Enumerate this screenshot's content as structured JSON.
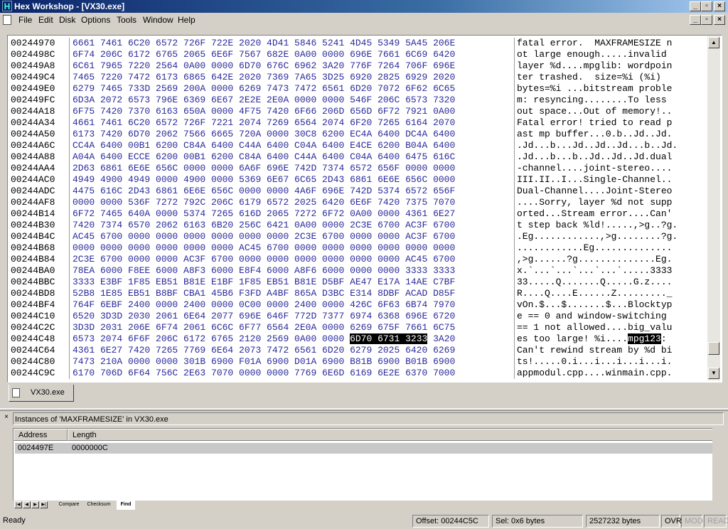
{
  "window": {
    "title": "Hex Workshop - [VX30.exe]"
  },
  "menu": [
    "File",
    "Edit",
    "Disk",
    "Options",
    "Tools",
    "Window",
    "Help"
  ],
  "hex_rows": [
    {
      "addr": "00244970",
      "hex": "6661 7461 6C20 6572 726F 722E 2020 4D41 5846 5241 4D45 5349 5A45 206E",
      "ascii": "fatal error.  MAXFRAMESIZE n"
    },
    {
      "addr": "0024498C",
      "hex": "6F74 206C 6172 6765 2065 6E6F 7567 682E 0A00 0000 696E 7661 6C69 6420",
      "ascii": "ot large enough.....invalid "
    },
    {
      "addr": "002449A8",
      "hex": "6C61 7965 7220 2564 0A00 0000 6D70 676C 6962 3A20 776F 7264 706F 696E",
      "ascii": "layer %d....mpglib: wordpoin"
    },
    {
      "addr": "002449C4",
      "hex": "7465 7220 7472 6173 6865 642E 2020 7369 7A65 3D25 6920 2825 6929 2020",
      "ascii": "ter trashed.  size=%i (%i)  "
    },
    {
      "addr": "002449E0",
      "hex": "6279 7465 733D 2569 200A 0000 6269 7473 7472 6561 6D20 7072 6F62 6C65",
      "ascii": "bytes=%i ...bitstream proble"
    },
    {
      "addr": "002449FC",
      "hex": "6D3A 2072 6573 796E 6369 6E67 2E2E 2E0A 0000 0000 546F 206C 6573 7320",
      "ascii": "m: resyncing........To less "
    },
    {
      "addr": "00244A18",
      "hex": "6F75 7420 7370 6163 650A 0000 4F75 7420 6F66 206D 656D 6F72 7921 0A00",
      "ascii": "out space...Out of memory!.."
    },
    {
      "addr": "00244A34",
      "hex": "4661 7461 6C20 6572 726F 7221 2074 7269 6564 2074 6F20 7265 6164 2070",
      "ascii": "Fatal error! tried to read p"
    },
    {
      "addr": "00244A50",
      "hex": "6173 7420 6D70 2062 7566 6665 720A 0000 30C8 6200 EC4A 6400 DC4A 6400",
      "ascii": "ast mp buffer...0.b..Jd..Jd."
    },
    {
      "addr": "00244A6C",
      "hex": "CC4A 6400 00B1 6200 C84A 6400 C44A 6400 C04A 6400 E4CE 6200 B04A 6400",
      "ascii": ".Jd...b...Jd..Jd..Jd...b..Jd."
    },
    {
      "addr": "00244A88",
      "hex": "A04A 6400 ECCE 6200 00B1 6200 C84A 6400 C44A 6400 C04A 6400 6475 616C",
      "ascii": ".Jd...b...b..Jd..Jd..Jd.dual"
    },
    {
      "addr": "00244AA4",
      "hex": "2D63 6861 6E6E 656C 0000 0000 6A6F 696E 742D 7374 6572 656F 0000 0000",
      "ascii": "-channel....joint-stereo...."
    },
    {
      "addr": "00244AC0",
      "hex": "4949 4900 4949 0000 4900 0000 5369 6E67 6C65 2D43 6861 6E6E 656C 0000",
      "ascii": "III.II..I...Single-Channel.."
    },
    {
      "addr": "00244ADC",
      "hex": "4475 616C 2D43 6861 6E6E 656C 0000 0000 4A6F 696E 742D 5374 6572 656F",
      "ascii": "Dual-Channel....Joint-Stereo"
    },
    {
      "addr": "00244AF8",
      "hex": "0000 0000 536F 7272 792C 206C 6179 6572 2025 6420 6E6F 7420 7375 7070",
      "ascii": "....Sorry, layer %d not supp"
    },
    {
      "addr": "00244B14",
      "hex": "6F72 7465 640A 0000 5374 7265 616D 2065 7272 6F72 0A00 0000 4361 6E27",
      "ascii": "orted...Stream error....Can'"
    },
    {
      "addr": "00244B30",
      "hex": "7420 7374 6570 2062 6163 6B20 256C 6421 0A00 0000 2C3E 6700 AC3F 6700",
      "ascii": "t step back %ld!.....,>g..?g."
    },
    {
      "addr": "00244B4C",
      "hex": "AC45 6700 0000 0000 0000 0000 0000 0000 2C3E 6700 0000 0000 AC3F 6700",
      "ascii": ".Eg............,>g........?g."
    },
    {
      "addr": "00244B68",
      "hex": "0000 0000 0000 0000 0000 0000 AC45 6700 0000 0000 0000 0000 0000 0000",
      "ascii": "............Eg.............."
    },
    {
      "addr": "00244B84",
      "hex": "2C3E 6700 0000 0000 AC3F 6700 0000 0000 0000 0000 0000 0000 AC45 6700",
      "ascii": ",>g......?g..............Eg."
    },
    {
      "addr": "00244BA0",
      "hex": "78EA 6000 F8EE 6000 A8F3 6000 E8F4 6000 A8F6 6000 0000 0000 3333 3333",
      "ascii": "x.`...`...`...`...`.....3333"
    },
    {
      "addr": "00244BBC",
      "hex": "3333 E3BF 1F85 EB51 B81E E1BF 1F85 EB51 B81E D5BF AE47 E17A 14AE C7BF",
      "ascii": "33.....Q.......Q.....G.z...."
    },
    {
      "addr": "00244BD8",
      "hex": "52B8 1E85 EB51 B8BF CBA1 45B6 F3FD A4BF 865A D3BC E314 8DBF ACAD D85F",
      "ascii": "R....Q....E......Z........._"
    },
    {
      "addr": "00244BF4",
      "hex": "764F 6EBF 2400 0000 2400 0000 0C00 0000 2400 0000 426C 6F63 6B74 7970",
      "ascii": "vOn.$...$.......$...Blocktyp"
    },
    {
      "addr": "00244C10",
      "hex": "6520 3D3D 2030 2061 6E64 2077 696E 646F 772D 7377 6974 6368 696E 6720",
      "ascii": "e == 0 and window-switching "
    },
    {
      "addr": "00244C2C",
      "hex": "3D3D 2031 206E 6F74 2061 6C6C 6F77 6564 2E0A 0000 6269 675F 7661 6C75",
      "ascii": "== 1 not allowed....big_valu"
    },
    {
      "addr": "00244C48",
      "hex": "6573 2074 6F6F 206C 6172 6765 2120 2569 0A00 0000 ",
      "hexsel": "6D70 6731 3233",
      "hexafter": " 3A20",
      "ascii": "es too large! %i....",
      "asciisel": "mpg123",
      "asciiafter": ": "
    },
    {
      "addr": "00244C64",
      "hex": "4361 6E27 7420 7265 7769 6E64 2073 7472 6561 6D20 6279 2025 6420 6269",
      "ascii": "Can't rewind stream by %d bi"
    },
    {
      "addr": "00244C80",
      "hex": "7473 210A 0000 0000 301B 6900 F01A 6900 D01A 6900 B81B 6900 B01B 6900",
      "ascii": "ts!.....0.i...i...i...i...i."
    },
    {
      "addr": "00244C9C",
      "hex": "6170 706D 6F64 756C 2E63 7070 0000 0000 7769 6E6D 6169 6E2E 6370 7000",
      "ascii": "appmodul.cpp....winmain.cpp."
    }
  ],
  "doc_tab": "VX30.exe",
  "find_panel": {
    "caption": "Instances of 'MAXFRAMESIZE' in VX30.exe",
    "columns": [
      "Address",
      "Length"
    ],
    "results": [
      {
        "address": "0024497E",
        "length": "0000000C"
      }
    ]
  },
  "bottom_tabs": [
    "Compare",
    "Checksum",
    "Find"
  ],
  "status": {
    "ready": "Ready",
    "offset": "Offset: 00244C5C",
    "selection": "Sel: 0x6 bytes",
    "filesize": "2527232 bytes",
    "ovr": "OVR",
    "mod": "MOD",
    "read": "READ"
  }
}
